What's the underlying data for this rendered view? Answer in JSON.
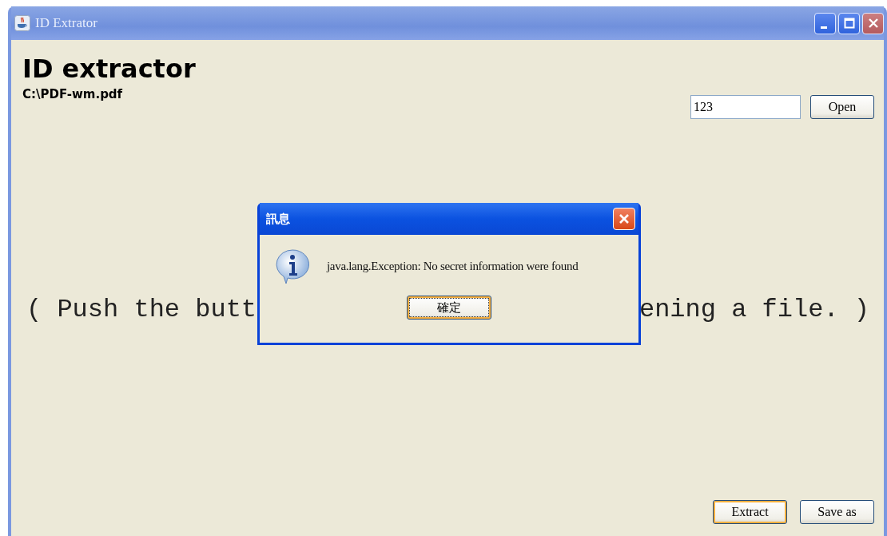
{
  "window": {
    "title": "ID Extrator"
  },
  "heading": "ID extractor",
  "file_path": "C:\\PDF-wm.pdf",
  "id_field": {
    "value": "123"
  },
  "open_button": {
    "label": "Open",
    "focused": false
  },
  "hint_fragments": [
    "( Push the butt",
    "ening a file. )"
  ],
  "buttons": [
    {
      "label": "Extract",
      "focused": true
    },
    {
      "label": "Save as",
      "focused": false
    }
  ],
  "dialog": {
    "title": "訊息",
    "message": "java.lang.Exception: No secret information were found",
    "button": {
      "label": "確定",
      "focused": true
    }
  }
}
